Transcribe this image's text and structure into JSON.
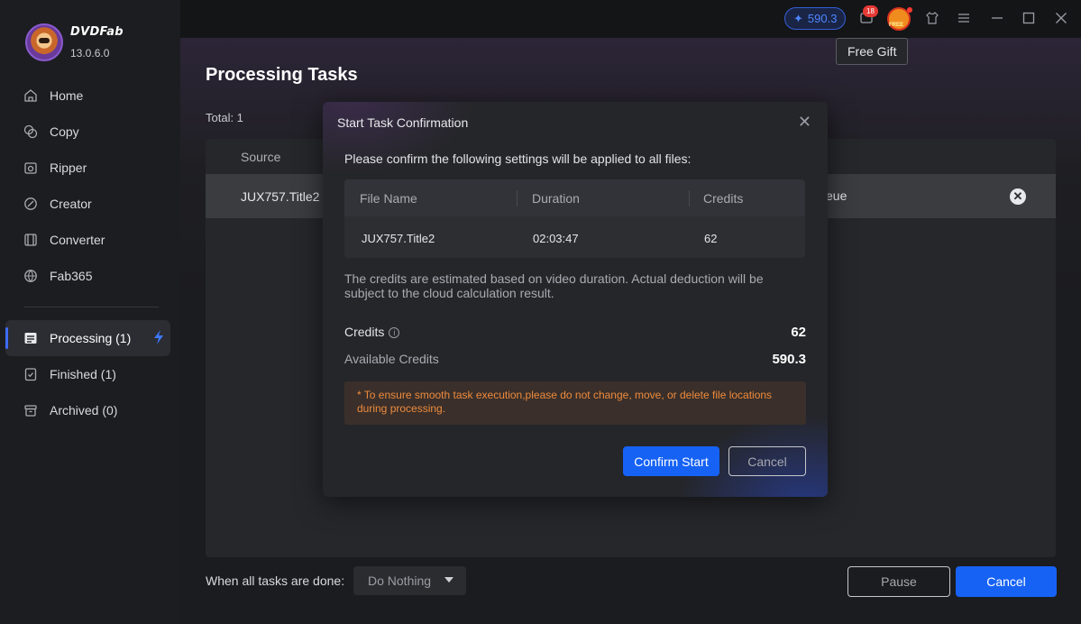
{
  "app": {
    "brand": "DVDFab",
    "version": "13.0.6.0"
  },
  "sidebar": {
    "items": [
      {
        "label": "Home",
        "icon": "home-icon"
      },
      {
        "label": "Copy",
        "icon": "copy-icon"
      },
      {
        "label": "Ripper",
        "icon": "ripper-icon"
      },
      {
        "label": "Creator",
        "icon": "creator-icon"
      },
      {
        "label": "Converter",
        "icon": "converter-icon"
      },
      {
        "label": "Fab365",
        "icon": "fab365-icon"
      }
    ],
    "task_items": [
      {
        "label": "Processing (1)",
        "icon": "processing-icon",
        "active": true
      },
      {
        "label": "Finished (1)",
        "icon": "finished-icon"
      },
      {
        "label": "Archived (0)",
        "icon": "archived-icon"
      }
    ]
  },
  "topbar": {
    "credits": "590.3",
    "notification_count": "18",
    "gift_label": "FREE",
    "tooltip": "Free Gift"
  },
  "main": {
    "title": "Processing Tasks",
    "total": "Total: 1",
    "table": {
      "header_source": "Source",
      "row_source": "JUX757.Title2",
      "row_status": "eue"
    },
    "footer_label": "When all tasks are done:",
    "footer_select": "Do Nothing",
    "pause_label": "Pause",
    "cancel_label": "Cancel"
  },
  "dialog": {
    "title": "Start Task Confirmation",
    "intro": "Please confirm the following settings will be applied to all files:",
    "columns": [
      "File Name",
      "Duration",
      "Credits"
    ],
    "row": [
      "JUX757.Title2",
      "02:03:47",
      "62"
    ],
    "note": "The credits are estimated based on video duration. Actual deduction will be subject to the cloud calculation result.",
    "credits_label": "Credits",
    "credits_value": "62",
    "available_label": "Available Credits",
    "available_value": "590.3",
    "warning": "* To ensure smooth task execution,please do not change, move, or delete file locations during processing.",
    "confirm_label": "Confirm Start",
    "cancel_label": "Cancel"
  },
  "colors": {
    "accent": "#1662f5",
    "warning": "#ee8b3d",
    "badge": "#e53935"
  }
}
